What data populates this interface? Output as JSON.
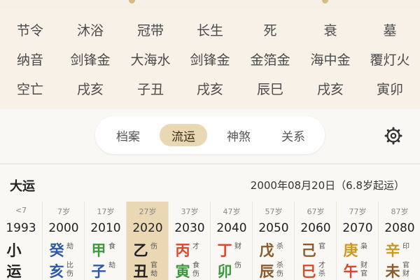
{
  "colors": {
    "wood": "#3c9a3c",
    "fire": "#d9482b",
    "earth": "#8a5a2a",
    "metal": "#c99a1e",
    "water": "#2d5aa8",
    "neutral": "#222222",
    "accent": "#ead7b4"
  },
  "info_table": {
    "rows": [
      [
        "节令",
        "沐浴",
        "冠带",
        "长生",
        "死",
        "衰",
        "墓"
      ],
      [
        "纳音",
        "剑锋金",
        "大海水",
        "剑锋金",
        "金箔金",
        "海中金",
        "覆灯火"
      ],
      [
        "空亡",
        "戌亥",
        "子丑",
        "戌亥",
        "辰巳",
        "戌亥",
        "寅卯"
      ]
    ]
  },
  "tabs": [
    "档案",
    "流运",
    "神煞",
    "关系"
  ],
  "active_tab": "流运",
  "settings_icon": "gear-icon",
  "dayun": {
    "title": "大运",
    "start_info": "2000年08月20日（6.8岁起运）",
    "columns": [
      {
        "age": "<7",
        "year": "1993",
        "stem": "小",
        "branch": "运",
        "stem_tag": "",
        "branch_tag": "",
        "stem_color": "neutral",
        "branch_color": "neutral",
        "current": false
      },
      {
        "age": "7岁",
        "year": "2000",
        "stem": "癸",
        "branch": "亥",
        "stem_tag": "劫",
        "branch_tag": "比\n伤",
        "stem_color": "water",
        "branch_color": "water",
        "current": false
      },
      {
        "age": "17岁",
        "year": "2010",
        "stem": "甲",
        "branch": "子",
        "stem_tag": "食",
        "branch_tag": "劫",
        "stem_color": "wood",
        "branch_color": "water",
        "current": false
      },
      {
        "age": "27岁",
        "year": "2020",
        "stem": "乙",
        "branch": "丑",
        "stem_tag": "伤",
        "branch_tag": "官\n劫",
        "stem_color": "neutral",
        "branch_color": "neutral",
        "current": true
      },
      {
        "age": "37岁",
        "year": "2030",
        "stem": "丙",
        "branch": "寅",
        "stem_tag": "才",
        "branch_tag": "食\n伤",
        "stem_color": "fire",
        "branch_color": "wood",
        "current": false
      },
      {
        "age": "47岁",
        "year": "2040",
        "stem": "丁",
        "branch": "卯",
        "stem_tag": "财",
        "branch_tag": "伤",
        "stem_color": "fire",
        "branch_color": "wood",
        "current": false
      },
      {
        "age": "57岁",
        "year": "2050",
        "stem": "戊",
        "branch": "辰",
        "stem_tag": "杀",
        "branch_tag": "杀\n伤",
        "stem_color": "earth",
        "branch_color": "earth",
        "current": false
      },
      {
        "age": "67岁",
        "year": "2060",
        "stem": "己",
        "branch": "巳",
        "stem_tag": "官",
        "branch_tag": "才\n杀",
        "stem_color": "earth",
        "branch_color": "fire",
        "current": false
      },
      {
        "age": "77岁",
        "year": "2070",
        "stem": "庚",
        "branch": "午",
        "stem_tag": "枭",
        "branch_tag": "财\n官",
        "stem_color": "metal",
        "branch_color": "fire",
        "current": false
      },
      {
        "age": "87岁",
        "year": "2080",
        "stem": "辛",
        "branch": "未",
        "stem_tag": "印",
        "branch_tag": "官\n财",
        "stem_color": "metal",
        "branch_color": "earth",
        "current": false
      }
    ]
  }
}
